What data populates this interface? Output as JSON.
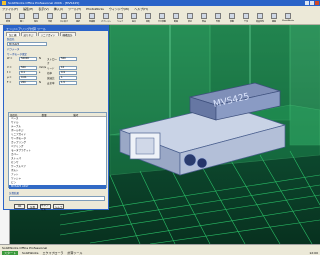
{
  "window": {
    "title": "SolidWorks Office Professional 2006 - [MVS425]",
    "controls": [
      "minimize",
      "maximize",
      "close"
    ]
  },
  "menu": {
    "items": [
      "ファイル(F)",
      "編集(E)",
      "表示(V)",
      "挿入(I)",
      "ツール(T)",
      "PhotoWorks",
      "ウィンドウ(W)",
      "ヘルプ(H)"
    ]
  },
  "toolbar": {
    "items": [
      "新規",
      "開く",
      "保存",
      "印刷",
      "元に戻す",
      "選択",
      "再構築",
      "オプション",
      "ヘルプ",
      "拡大",
      "回転",
      "平行移動",
      "断面",
      "表示",
      "部品",
      "合致",
      "移動",
      "干渉",
      "質量特性",
      "図面",
      "PhotoWorks"
    ]
  },
  "dialog": {
    "title": "エンジニアリング計算 ツール",
    "tabs": [
      "加工機",
      "送りネジ",
      "リニアガイド",
      "機構設計"
    ],
    "name_label": "製品名",
    "name_value": "MVS425",
    "params_label": "パラメータ",
    "grid_label": "サーボモータ選定",
    "grid_rows": [
      {
        "a": "W =",
        "b": "50000",
        "c": "N",
        "d": "ストローク",
        "e": "500"
      },
      {
        "a": "V =",
        "b": "500",
        "c": "mm/s",
        "d": "リード",
        "e": "10"
      },
      {
        "a": "t =",
        "b": "0.1",
        "c": "s",
        "d": "効率",
        "e": "0.9"
      },
      {
        "a": "μ =",
        "b": "0.01",
        "c": "",
        "d": "減速比",
        "e": "1"
      },
      {
        "a": "F =",
        "b": "200",
        "c": "N",
        "d": "安全率",
        "e": "1.5"
      }
    ],
    "list_headers": [
      "部品名",
      "数量",
      "備考"
    ],
    "list_items": [
      "ベース",
      "サドル",
      "テーブル",
      "ボールネジ",
      "リニアガイド",
      "サーボモータ",
      "カップリング",
      "ベアリング",
      "モータブラケット",
      "カバー",
      "ストッパ",
      "センサ",
      "ケーブルベア",
      "ボルト",
      "ナット",
      "ワッシャ",
      "ピン",
      "MVS425 ASSY"
    ],
    "selected_index": 17,
    "bottom_label": "計算結果",
    "buttons": [
      "OK",
      "計算",
      "キャンセル",
      "ヘルプ"
    ]
  },
  "model": {
    "label": "MVS425"
  },
  "status": {
    "text": "SolidWorks Office Professional",
    "start_label": "スタート",
    "tasks": [
      "SolidWorks",
      "エクスプローラ",
      "計算ツール"
    ],
    "clock": "12:00"
  }
}
